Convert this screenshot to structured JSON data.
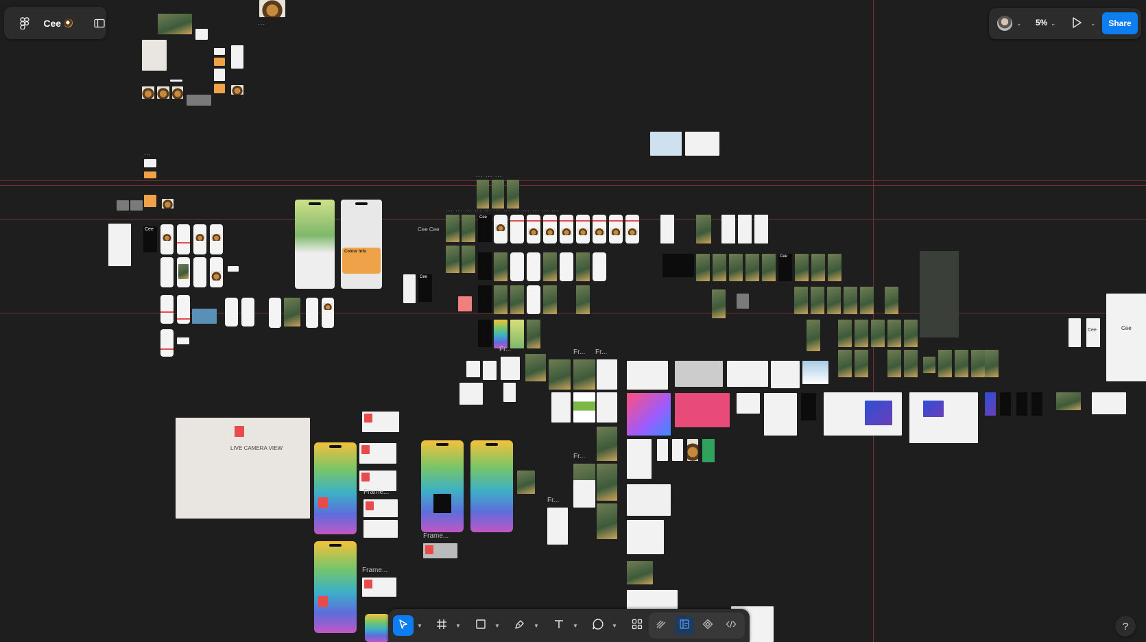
{
  "app": {
    "file_name": "Cee",
    "icons": {
      "main_menu": "figma-logo-icon",
      "file_emoji": "cookie-icon",
      "panels_toggle": "sidebar-toggle-icon"
    }
  },
  "header_right": {
    "zoom": "5%",
    "share_label": "Share",
    "icons": {
      "avatar": "user-avatar",
      "present": "play-icon"
    }
  },
  "canvas": {
    "labels": {
      "cee": "Cee",
      "cee_cee": "Cee Cee",
      "frame_ellipsis": "Frame...",
      "fr_ellipsis": "Fr...",
      "sketch_text": "LIVE CAMERA VIEW",
      "colour_info": "Colour Info"
    }
  },
  "bottom_toolbar": {
    "tools": [
      {
        "name": "move",
        "icon": "cursor-icon",
        "active": true
      },
      {
        "name": "frame",
        "icon": "frame-icon"
      },
      {
        "name": "shape",
        "icon": "rectangle-icon"
      },
      {
        "name": "pen",
        "icon": "pen-icon"
      },
      {
        "name": "text",
        "icon": "text-icon"
      },
      {
        "name": "comment",
        "icon": "comment-icon"
      },
      {
        "name": "actions",
        "icon": "actions-grid-icon"
      }
    ],
    "modes": [
      {
        "name": "draw",
        "icon": "draw-icon"
      },
      {
        "name": "design",
        "icon": "design-mode-icon",
        "active": true
      },
      {
        "name": "components",
        "icon": "component-icon"
      },
      {
        "name": "dev-mode",
        "icon": "code-icon"
      }
    ]
  },
  "help": {
    "label": "?"
  },
  "colors": {
    "canvas_bg": "#1e1e1e",
    "panel_bg": "#2c2c2c",
    "accent": "#0d7ef2",
    "guide": "#7a3030"
  }
}
